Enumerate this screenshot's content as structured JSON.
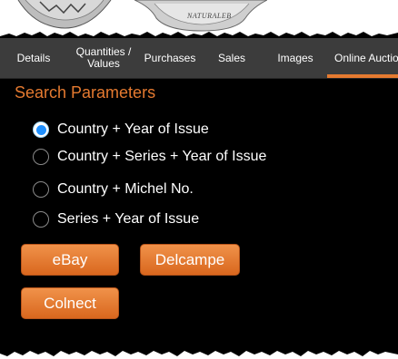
{
  "header": {
    "thumbnail_text": "NATURALEB"
  },
  "tabs": [
    {
      "label": "Details"
    },
    {
      "label": "Quantities / Values"
    },
    {
      "label": "Purchases"
    },
    {
      "label": "Sales"
    },
    {
      "label": "Images"
    },
    {
      "label": "Online Auction",
      "active": true
    }
  ],
  "search": {
    "title": "Search Parameters",
    "options": [
      {
        "label": "Country + Year of Issue",
        "selected": true
      },
      {
        "label": "Country + Series + Year of Issue",
        "selected": false
      },
      {
        "label": "Country + Michel No.",
        "selected": false
      },
      {
        "label": "Series + Year of Issue",
        "selected": false
      }
    ]
  },
  "buttons": {
    "ebay": "eBay",
    "delcampe": "Delcampe",
    "colnect": "Colnect"
  },
  "colors": {
    "accent": "#e57a30",
    "radio_selected": "#1e90ff",
    "tab_bar": "#3c3c3c",
    "background": "#000000"
  }
}
